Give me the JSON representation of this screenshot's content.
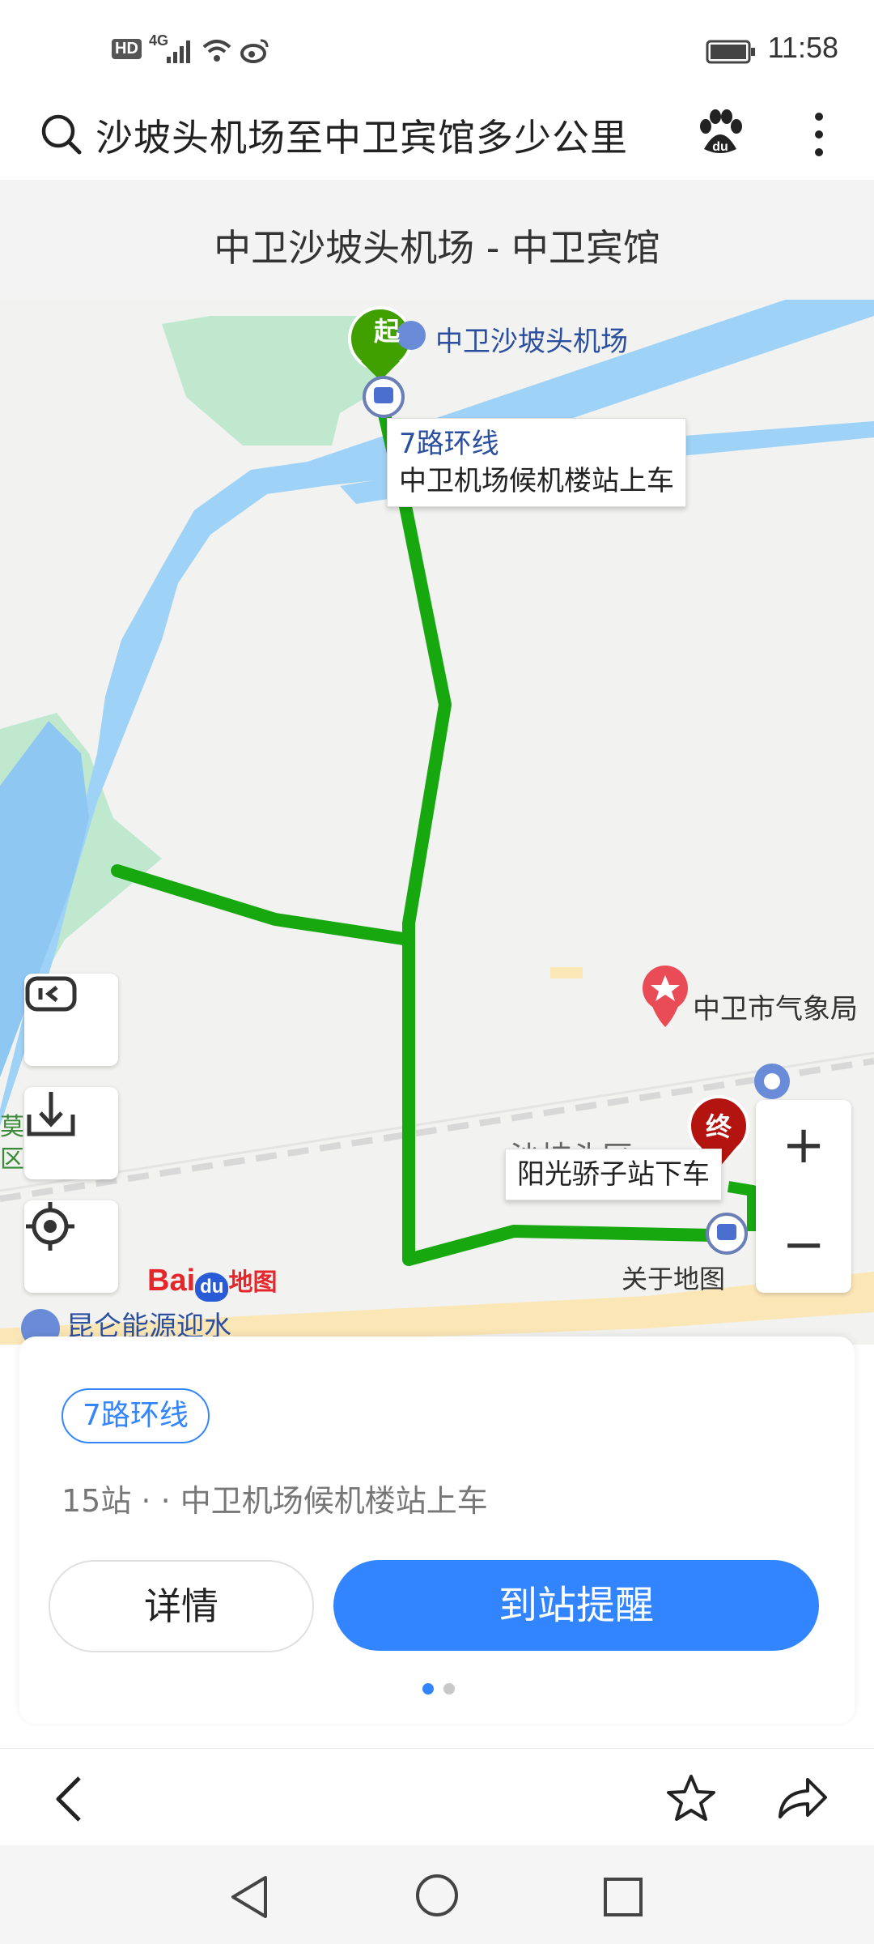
{
  "status_bar": {
    "time": "11:58",
    "hd_label": "HD",
    "network_label": "4G",
    "icons": [
      "hd-icon",
      "signal-icon",
      "wifi-icon",
      "weibo-icon",
      "battery-icon"
    ]
  },
  "search": {
    "query": "沙坡头机场至中卫宾馆多少公里",
    "icons": [
      "search-icon",
      "baidu-paw-icon",
      "more-vertical-icon"
    ]
  },
  "route": {
    "title": "中卫沙坡头机场 - 中卫宾馆"
  },
  "map": {
    "start_marker": "起",
    "end_marker": "终",
    "airport_label": "中卫沙坡头机场",
    "boarding_callout_line": "7路环线",
    "boarding_callout_stop": "中卫机场候机楼站上车",
    "weather_bureau_label": "中卫市气象局",
    "district_label_partial": "沙坡头区",
    "alight_callout": "阳光骄子站下车",
    "about_map_label": "关于地图",
    "gas_station_label": "昆仑能源迎水",
    "left_edge_label_1": "莫",
    "left_edge_label_2": "区",
    "baidu_logo_text_bai": "Bai",
    "baidu_logo_text_du": "du",
    "baidu_logo_text_map": "地图",
    "zoom_in_symbol": "+",
    "zoom_out_symbol": "−",
    "route_color": "#17a80f",
    "water_color": "#9fd2f7",
    "green_area_color": "#bfe8cf"
  },
  "card": {
    "line_badge": "7路环线",
    "line_info": "15站 · · 中卫机场候机楼站上车",
    "details_button": "详情",
    "remind_button": "到站提醒",
    "page_dots_total": 2,
    "page_dots_active": 1,
    "accent_color": "#3385ff"
  },
  "browser_bar": {
    "icons": [
      "back-arrow-icon",
      "star-icon",
      "share-icon"
    ]
  },
  "nav_bar": {
    "icons": [
      "nav-back-icon",
      "nav-home-icon",
      "nav-recents-icon"
    ]
  }
}
